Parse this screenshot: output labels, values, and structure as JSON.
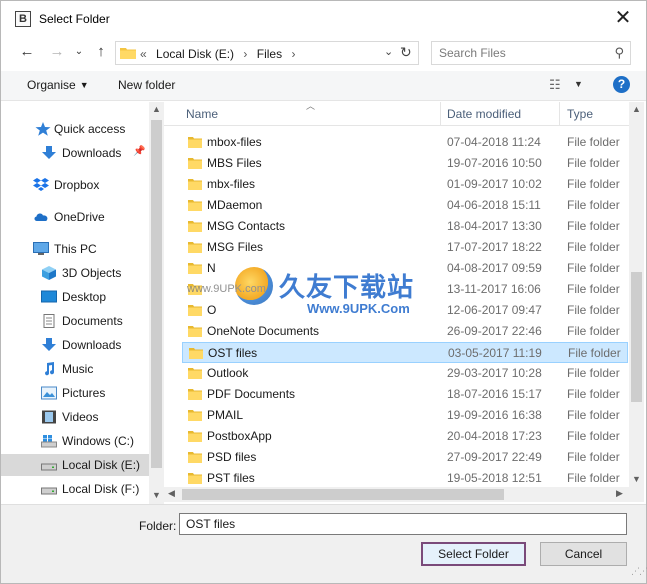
{
  "window": {
    "title": "Select Folder",
    "app_icon_letter": "B"
  },
  "nav": {
    "address": {
      "overflow": "«",
      "parts": [
        "Local Disk (E:)",
        "Files"
      ],
      "separator": "›"
    },
    "search_placeholder": "Search Files"
  },
  "toolbar": {
    "organise": "Organise",
    "new_folder": "New folder"
  },
  "sidebar": {
    "items": [
      {
        "label": "Quick access",
        "icon": "star-icon",
        "pinned": false
      },
      {
        "label": "Downloads",
        "icon": "download-arrow-icon",
        "pinned": true
      },
      {
        "label": "Dropbox",
        "icon": "dropbox-icon"
      },
      {
        "label": "OneDrive",
        "icon": "cloud-icon"
      },
      {
        "label": "This PC",
        "icon": "computer-icon"
      },
      {
        "label": "3D Objects",
        "icon": "cube-icon"
      },
      {
        "label": "Desktop",
        "icon": "desktop-icon"
      },
      {
        "label": "Documents",
        "icon": "document-icon"
      },
      {
        "label": "Downloads",
        "icon": "download-arrow-icon"
      },
      {
        "label": "Music",
        "icon": "music-icon"
      },
      {
        "label": "Pictures",
        "icon": "pictures-icon"
      },
      {
        "label": "Videos",
        "icon": "film-icon"
      },
      {
        "label": "Windows (C:)",
        "icon": "windows-drive-icon"
      },
      {
        "label": "Local Disk (E:)",
        "icon": "drive-icon",
        "selected": true
      },
      {
        "label": "Local Disk (F:)",
        "icon": "drive-icon"
      }
    ]
  },
  "columns": {
    "name": "Name",
    "date": "Date modified",
    "type": "Type"
  },
  "files": [
    {
      "name": "mbox-files",
      "date": "07-04-2018 11:24",
      "type": "File folder"
    },
    {
      "name": "MBS Files",
      "date": "19-07-2016 10:50",
      "type": "File folder"
    },
    {
      "name": "mbx-files",
      "date": "01-09-2017 10:02",
      "type": "File folder"
    },
    {
      "name": "MDaemon",
      "date": "04-06-2018 15:11",
      "type": "File folder"
    },
    {
      "name": "MSG Contacts",
      "date": "18-04-2017 13:30",
      "type": "File folder"
    },
    {
      "name": "MSG Files",
      "date": "17-07-2017 18:22",
      "type": "File folder"
    },
    {
      "name": "N",
      "date": "04-08-2017 09:59",
      "type": "File folder"
    },
    {
      "name": "",
      "date": "13-11-2017 16:06",
      "type": "File folder"
    },
    {
      "name": "O",
      "date": "12-06-2017 09:47",
      "type": "File folder"
    },
    {
      "name": "OneNote Documents",
      "date": "26-09-2017 22:46",
      "type": "File folder"
    },
    {
      "name": "OST files",
      "date": "03-05-2017 11:19",
      "type": "File folder",
      "selected": true
    },
    {
      "name": "Outlook",
      "date": "29-03-2017 10:28",
      "type": "File folder"
    },
    {
      "name": "PDF Documents",
      "date": "18-07-2016 15:17",
      "type": "File folder"
    },
    {
      "name": "PMAIL",
      "date": "19-09-2016 16:38",
      "type": "File folder"
    },
    {
      "name": "PostboxApp",
      "date": "20-04-2018 17:23",
      "type": "File folder"
    },
    {
      "name": "PSD files",
      "date": "27-09-2017 22:49",
      "type": "File folder"
    },
    {
      "name": "PST files",
      "date": "19-05-2018 12:51",
      "type": "File folder"
    }
  ],
  "footer": {
    "folder_label": "Folder:",
    "folder_value": "OST files",
    "select_label": "Select Folder",
    "cancel_label": "Cancel"
  },
  "watermark": {
    "cn": "久友下载站",
    "url_small": "www.9UPK.com",
    "url_big": "Www.9UPK.Com"
  },
  "colors": {
    "accent": "#1e6fc7",
    "folder": "#f4c542",
    "selected_row": "#cce8ff",
    "selected_border": "#99d1ff",
    "nav_selected": "#d9d9d9"
  }
}
